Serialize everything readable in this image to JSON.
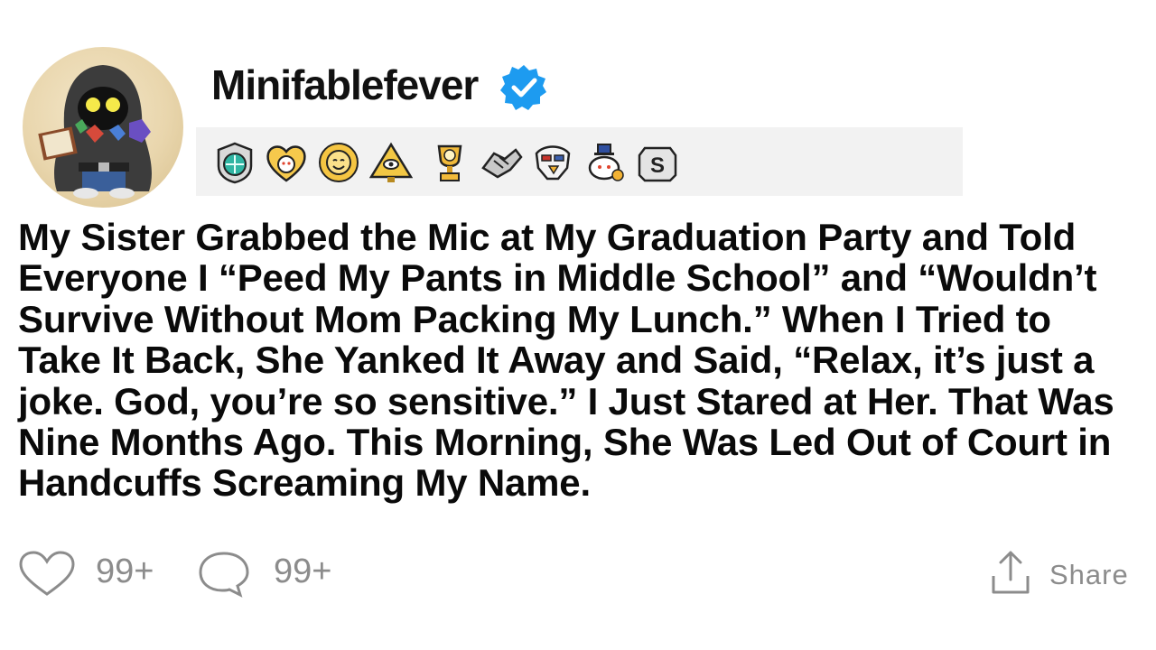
{
  "post": {
    "username": "Minifablefever",
    "verified_icon": "verified-badge-icon",
    "title": "My Sister Grabbed the Mic at My Graduation Party and Told Everyone I “Peed My Pants in Middle School” and “Wouldn’t Survive Without Mom Packing My Lunch.” When I Tried to Take It Back, She Yanked It Away and Said, “Relax, it’s just a joke. God, you’re so sensitive.” I Just Stared at Her. That Was Nine Months Ago. This Morning, She Was Led Out of Court in Handcuffs Screaming My Name."
  },
  "awards": [
    "shield-gem-award-icon",
    "heart-snoo-award-icon",
    "sun-face-award-icon",
    "pyramid-eye-award-icon",
    "gold-trophy-snoo-award-icon",
    "handshake-award-icon",
    "eagle-award-icon",
    "snoo-top-hat-award-icon",
    "silver-s-award-icon"
  ],
  "footer": {
    "likes": "99+",
    "comments": "99+",
    "share_label": "Share"
  },
  "colors": {
    "text": "#0a0a0a",
    "muted": "#8c8c8c",
    "verified": "#1d9bf0",
    "awards_bg": "#f2f2f2"
  }
}
